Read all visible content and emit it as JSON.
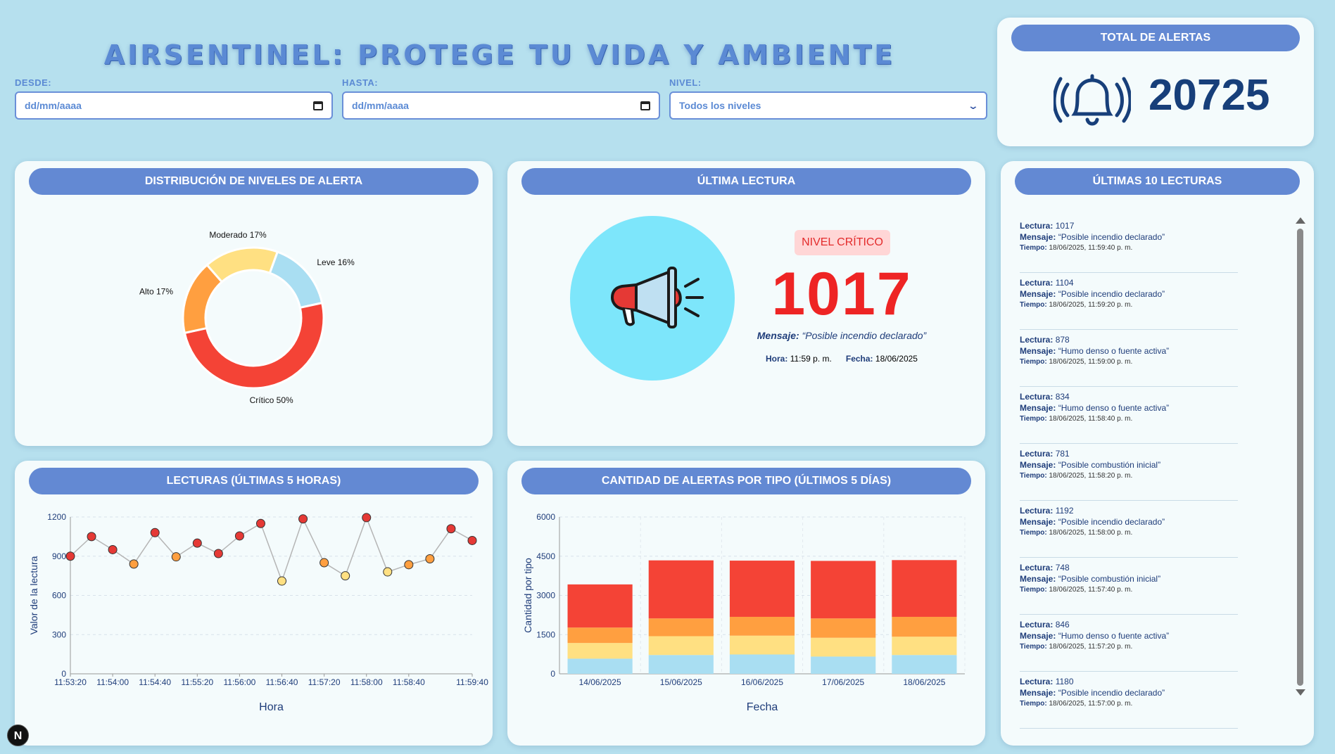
{
  "header": {
    "title": "AIRSENTINEL: PROTEGE TU VIDA Y AMBIENTE"
  },
  "filters": {
    "desde_label": "DESDE:",
    "desde_value": "dd/mm/aaaa",
    "hasta_label": "HASTA:",
    "hasta_value": "dd/mm/aaaa",
    "nivel_label": "NIVEL:",
    "nivel_value": "Todos los niveles"
  },
  "total": {
    "title": "TOTAL DE ALERTAS",
    "value": "20725",
    "icon": "bell-icon"
  },
  "distribution": {
    "title": "DISTRIBUCIÓN DE NIVELES DE ALERTA",
    "chart_data": {
      "type": "pie",
      "slices": [
        {
          "label": "Leve 16%",
          "name": "Leve",
          "value": 16,
          "color": "#a9def2"
        },
        {
          "label": "Crítico 50%",
          "name": "Crítico",
          "value": 50,
          "color": "#f44336"
        },
        {
          "label": "Alto 17%",
          "name": "Alto",
          "value": 17,
          "color": "#ff9f40"
        },
        {
          "label": "Moderado 17%",
          "name": "Moderado",
          "value": 17,
          "color": "#ffe082"
        }
      ]
    }
  },
  "last_reading": {
    "title": "ÚLTIMA LECTURA",
    "icon": "megaphone-icon",
    "level_badge": "NIVEL CRÍTICO",
    "value": "1017",
    "message_label": "Mensaje:",
    "message": "“Posible incendio declarado”",
    "hora_label": "Hora:",
    "hora": "11:59 p. m.",
    "fecha_label": "Fecha:",
    "fecha": "18/06/2025"
  },
  "last10": {
    "title": "ÚLTIMAS 10 LECTURAS",
    "lectura_label": "Lectura:",
    "mensaje_label": "Mensaje:",
    "tiempo_label": "Tiempo:",
    "items": [
      {
        "lectura": "1017",
        "mensaje": "“Posible incendio declarado”",
        "tiempo": "18/06/2025, 11:59:40 p. m."
      },
      {
        "lectura": "1104",
        "mensaje": "“Posible incendio declarado”",
        "tiempo": "18/06/2025, 11:59:20 p. m."
      },
      {
        "lectura": "878",
        "mensaje": "“Humo denso o fuente activa”",
        "tiempo": "18/06/2025, 11:59:00 p. m."
      },
      {
        "lectura": "834",
        "mensaje": "“Humo denso o fuente activa”",
        "tiempo": "18/06/2025, 11:58:40 p. m."
      },
      {
        "lectura": "781",
        "mensaje": "“Posible combustión inicial”",
        "tiempo": "18/06/2025, 11:58:20 p. m."
      },
      {
        "lectura": "1192",
        "mensaje": "“Posible incendio declarado”",
        "tiempo": "18/06/2025, 11:58:00 p. m."
      },
      {
        "lectura": "748",
        "mensaje": "“Posible combustión inicial”",
        "tiempo": "18/06/2025, 11:57:40 p. m."
      },
      {
        "lectura": "846",
        "mensaje": "“Humo denso o fuente activa”",
        "tiempo": "18/06/2025, 11:57:20 p. m."
      },
      {
        "lectura": "1180",
        "mensaje": "“Posible incendio declarado”",
        "tiempo": "18/06/2025, 11:57:00 p. m."
      }
    ]
  },
  "readings_chart": {
    "title": "LECTURAS (ÚLTIMAS 5 HORAS)",
    "chart_data": {
      "type": "line",
      "xlabel": "Hora",
      "ylabel": "Valor de la lectura",
      "ylim": [
        0,
        1200
      ],
      "yticks": [
        0,
        300,
        600,
        900,
        1200
      ],
      "xtick_labels": [
        "11:53:20",
        "11:54:00",
        "11:54:40",
        "11:55:20",
        "11:56:00",
        "11:56:40",
        "11:57:20",
        "11:58:00",
        "11:58:40",
        "11:59:40"
      ],
      "x": [
        "11:53:20",
        "11:53:40",
        "11:54:00",
        "11:54:20",
        "11:54:40",
        "11:55:00",
        "11:55:20",
        "11:55:40",
        "11:56:00",
        "11:56:20",
        "11:56:40",
        "11:57:00",
        "11:57:20",
        "11:57:40",
        "11:58:00",
        "11:58:20",
        "11:58:40",
        "11:59:00",
        "11:59:20",
        "11:59:40"
      ],
      "values": [
        900,
        1050,
        950,
        840,
        1080,
        895,
        1000,
        920,
        1055,
        1150,
        710,
        1185,
        850,
        750,
        1195,
        780,
        835,
        880,
        1110,
        1020
      ],
      "level_colors": [
        "#e53935",
        "#e53935",
        "#e53935",
        "#ff9f40",
        "#e53935",
        "#ff9f40",
        "#e53935",
        "#e53935",
        "#e53935",
        "#e53935",
        "#ffe082",
        "#e53935",
        "#ff9f40",
        "#ffe082",
        "#e53935",
        "#ffe082",
        "#ff9f40",
        "#ff9f40",
        "#e53935",
        "#e53935"
      ]
    }
  },
  "alerts_chart": {
    "title": "CANTIDAD DE ALERTAS POR TIPO (ÚLTIMOS 5 DÍAS)",
    "chart_data": {
      "type": "bar",
      "stacked": true,
      "xlabel": "Fecha",
      "ylabel": "Cantidad por tipo",
      "ylim": [
        0,
        6000
      ],
      "yticks": [
        0,
        1500,
        3000,
        4500,
        6000
      ],
      "categories": [
        "14/06/2025",
        "15/06/2025",
        "16/06/2025",
        "17/06/2025",
        "18/06/2025"
      ],
      "series": [
        {
          "values": [
            580,
            720,
            740,
            660,
            720
          ],
          "color": "#a9def2"
        },
        {
          "values": [
            600,
            720,
            720,
            720,
            700
          ],
          "color": "#ffe082"
        },
        {
          "values": [
            590,
            680,
            720,
            740,
            760
          ],
          "color": "#ff9f40"
        },
        {
          "values": [
            1650,
            2220,
            2150,
            2200,
            2170
          ],
          "color": "#f44336"
        }
      ]
    }
  }
}
